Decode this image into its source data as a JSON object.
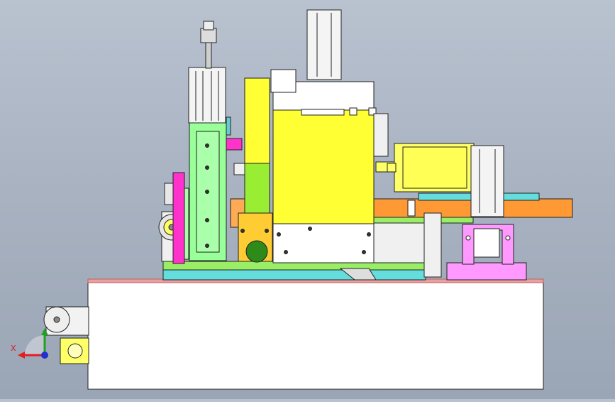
{
  "viewport": {
    "axis_triad": {
      "x_label": "X",
      "x_color": "#e02020",
      "y_color": "#20a020",
      "z_color": "#2030d0"
    }
  },
  "colors": {
    "background": "#a9b3c2",
    "base_plate": "#ffffff",
    "base_top_strip": "#e08a8a",
    "yellow_housing": "#ffff33",
    "servo_motor": "#ffff66",
    "green_column": "#99ff99",
    "magenta_part": "#ff33cc",
    "pink_block": "#ff99ff",
    "orange_bar": "#ff9933",
    "cyan_base": "#66dddd",
    "motor_white": "#f4f4f4",
    "dark_green_roller": "#2e8b1a"
  }
}
